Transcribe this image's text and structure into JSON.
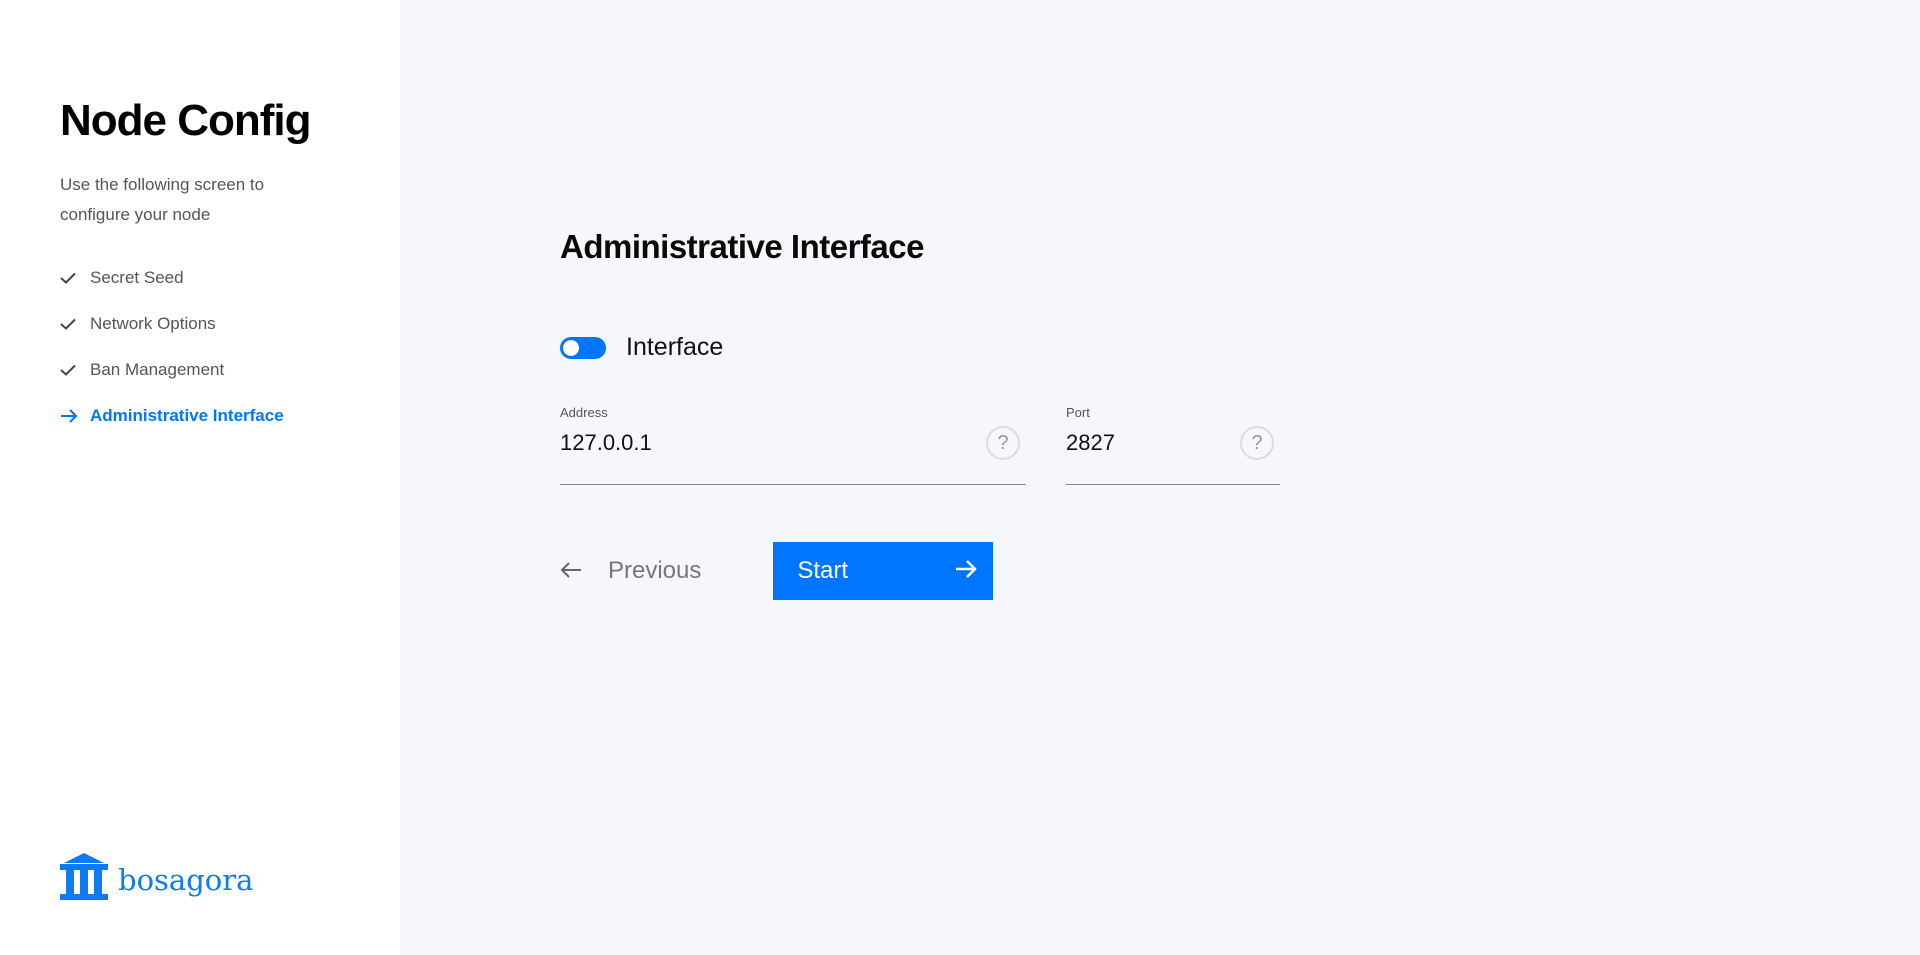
{
  "sidebar": {
    "title": "Node Config",
    "description": "Use the following screen to configure your node",
    "steps": [
      {
        "label": "Secret Seed",
        "status": "done",
        "icon": "check-icon"
      },
      {
        "label": "Network Options",
        "status": "done",
        "icon": "check-icon"
      },
      {
        "label": "Ban Management",
        "status": "done",
        "icon": "check-icon"
      },
      {
        "label": "Administrative Interface",
        "status": "current",
        "icon": "arrow-right-icon"
      }
    ],
    "logo_text": "bosagora"
  },
  "main": {
    "title": "Administrative Interface",
    "toggle": {
      "label": "Interface",
      "enabled": true
    },
    "fields": {
      "address": {
        "label": "Address",
        "value": "127.0.0.1",
        "help": "?"
      },
      "port": {
        "label": "Port",
        "value": "2827",
        "help": "?"
      }
    },
    "previous_label": "Previous",
    "start_label": "Start"
  },
  "colors": {
    "accent": "#0076ff",
    "sidebar_bg": "#ffffff",
    "main_bg": "#f6f7fb"
  }
}
